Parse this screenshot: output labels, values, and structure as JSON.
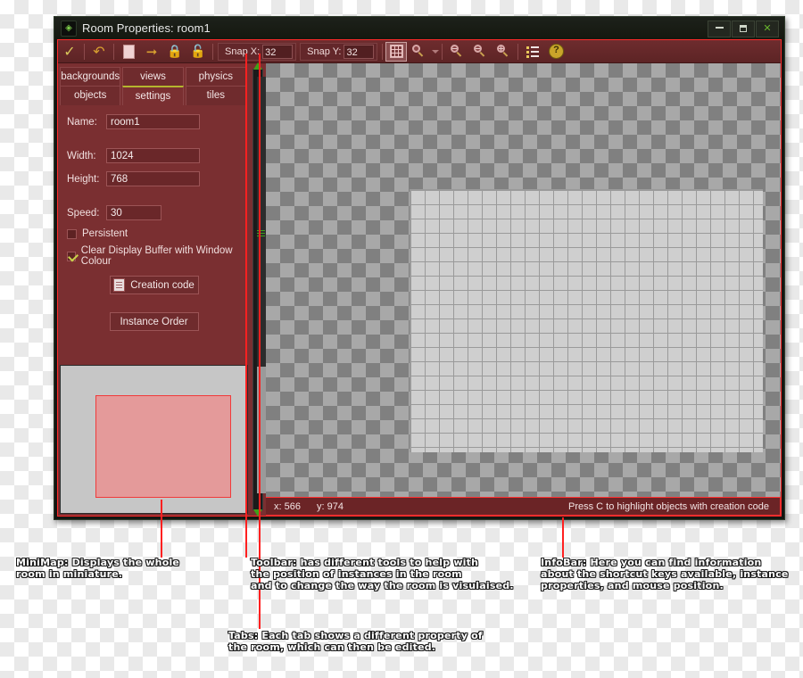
{
  "window": {
    "title": "Room Properties: room1",
    "icon": "gamemaker-icon",
    "buttons": {
      "minimize": "–",
      "maximize": "□",
      "close": "✕"
    }
  },
  "toolbar": {
    "items": [
      {
        "name": "confirm-check",
        "glyph": "✓"
      },
      {
        "name": "undo-arrow",
        "glyph": "↶"
      },
      {
        "name": "clear-page",
        "glyph": "□"
      },
      {
        "name": "shift-right-arrow",
        "glyph": "→"
      },
      {
        "name": "lock-closed",
        "glyph": "ὑ2"
      },
      {
        "name": "lock-open",
        "glyph": "ὑ3"
      }
    ],
    "snap_x_label": "Snap X:",
    "snap_x_value": "32",
    "snap_y_label": "Snap Y:",
    "snap_y_value": "32",
    "grid_toggle": "grid-icon",
    "grid_zoom": "magnifier-icon",
    "zoom_out": "zoom-out-icon",
    "zoom_reset": "zoom-reset-icon",
    "zoom_in": "zoom-in-icon",
    "object_list": "list-icon",
    "help": "?"
  },
  "tabs": {
    "row1": [
      {
        "label": "backgrounds",
        "active": false
      },
      {
        "label": "views",
        "active": false
      },
      {
        "label": "physics",
        "active": false
      }
    ],
    "row2": [
      {
        "label": "objects",
        "active": false
      },
      {
        "label": "settings",
        "active": true
      },
      {
        "label": "tiles",
        "active": false
      }
    ]
  },
  "settings": {
    "name_label": "Name:",
    "name_value": "room1",
    "width_label": "Width:",
    "width_value": "1024",
    "height_label": "Height:",
    "height_value": "768",
    "speed_label": "Speed:",
    "speed_value": "30",
    "persistent_label": "Persistent",
    "persistent_checked": false,
    "clear_buffer_label": "Clear Display Buffer with Window Colour",
    "clear_buffer_checked": true,
    "creation_code_label": "Creation code",
    "instance_order_label": "Instance Order"
  },
  "statusbar": {
    "x_text": "x: 566",
    "y_text": "y: 974",
    "hint": "Press C to highlight objects with creation code"
  },
  "annotations": {
    "minimap": "MiniMap: Displays the whole\nroom in miniature.",
    "toolbar": "Toolbar: has different tools to help with\nthe position of instances in the room\nand to change the way the room is visulaised.",
    "infobar": "InfoBar: Here you can find information\nabout the shortcut keys available, instance\nproperties, and mouse position.",
    "tabs": "Tabs: Each tab shows a different property of\nthe room, which can then be edited."
  },
  "colors": {
    "accent_red": "#ff2020",
    "panel_red": "#7a2f31",
    "toolbar_red": "#6e2c2e",
    "active_tab_border": "#b5b52e",
    "minimap_room": "#e49a9a",
    "window_frame": "#141612"
  }
}
